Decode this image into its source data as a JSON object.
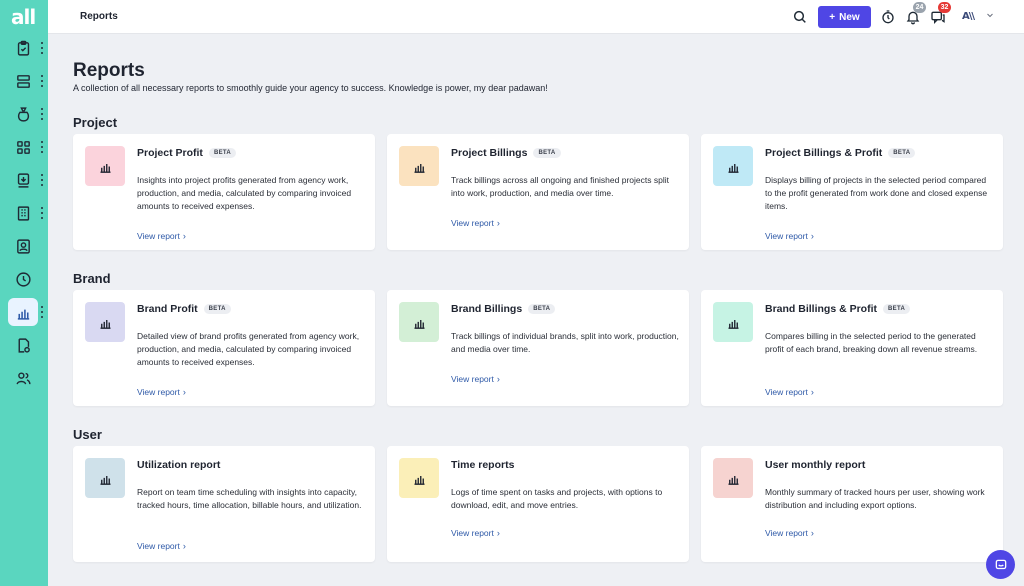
{
  "app": {
    "logo": "all"
  },
  "sidebar": {
    "items": [
      {
        "icon": "clipboard-check-icon"
      },
      {
        "icon": "server-stack-icon"
      },
      {
        "icon": "money-bag-icon"
      },
      {
        "icon": "grid-icon"
      },
      {
        "icon": "invoice-download-icon"
      },
      {
        "icon": "building-icon"
      },
      {
        "icon": "user-card-icon"
      },
      {
        "icon": "clock-icon"
      },
      {
        "icon": "bar-chart-icon",
        "active": true
      },
      {
        "icon": "document-settings-icon"
      },
      {
        "icon": "users-icon"
      }
    ]
  },
  "header": {
    "breadcrumb": "Reports",
    "new_label": "New",
    "notifications_count": "24",
    "messages_count": "32",
    "account_logo": "A\\\\"
  },
  "page": {
    "title": "Reports",
    "subtitle": "A collection of all necessary reports to smoothly guide your agency to success. Knowledge is power, my dear padawan!"
  },
  "sections": [
    {
      "title": "Project",
      "cards": [
        {
          "title": "Project Profit",
          "beta": "BETA",
          "color": "#fbd3dc",
          "desc": "Insights into project profits generated from agency work, production, and media, calculated by comparing invoiced amounts to received expenses.",
          "link": "View report"
        },
        {
          "title": "Project Billings",
          "beta": "BETA",
          "color": "#fbe2bf",
          "desc": "Track billings across all ongoing and finished projects split into work, production, and media over time.",
          "link": "View report"
        },
        {
          "title": "Project Billings & Profit",
          "beta": "BETA",
          "color": "#bfe9f6",
          "desc": "Displays billing of projects in the selected period compared to the profit generated from work done and closed expense items.",
          "link": "View report"
        }
      ]
    },
    {
      "title": "Brand",
      "cards": [
        {
          "title": "Brand Profit",
          "beta": "BETA",
          "color": "#d9d9f2",
          "desc": "Detailed view of brand profits generated from agency work, production, and media, calculated by comparing invoiced amounts to received expenses.",
          "link": "View report"
        },
        {
          "title": "Brand Billings",
          "beta": "BETA",
          "color": "#d3efd6",
          "desc": "Track billings of individual brands, split into work, production, and media over time.",
          "link": "View report"
        },
        {
          "title": "Brand Billings & Profit",
          "beta": "BETA",
          "color": "#c6f3e4",
          "desc": "Compares billing in the selected period to the generated profit of each brand, breaking down all revenue streams.",
          "link": "View report"
        }
      ]
    },
    {
      "title": "User",
      "cards": [
        {
          "title": "Utilization report",
          "beta": "",
          "color": "#cfe1ea",
          "desc": "Report on team time scheduling with insights into capacity, tracked hours, time allocation, billable hours, and utilization.",
          "link": "View report"
        },
        {
          "title": "Time reports",
          "beta": "",
          "color": "#fbefb8",
          "desc": "Logs of time spent on tasks and projects, with options to download, edit, and move entries.",
          "link": "View report"
        },
        {
          "title": "User monthly report",
          "beta": "",
          "color": "#f6d3d0",
          "desc": "Monthly summary of tracked hours per user, showing work distribution and including export options.",
          "link": "View report"
        }
      ]
    }
  ],
  "colors": {
    "sidebar": "#5ad6bf",
    "accent": "#4f46e5",
    "link": "#2f5aa8",
    "badge_red": "#e53935",
    "badge_gray": "#9aa3ad"
  }
}
